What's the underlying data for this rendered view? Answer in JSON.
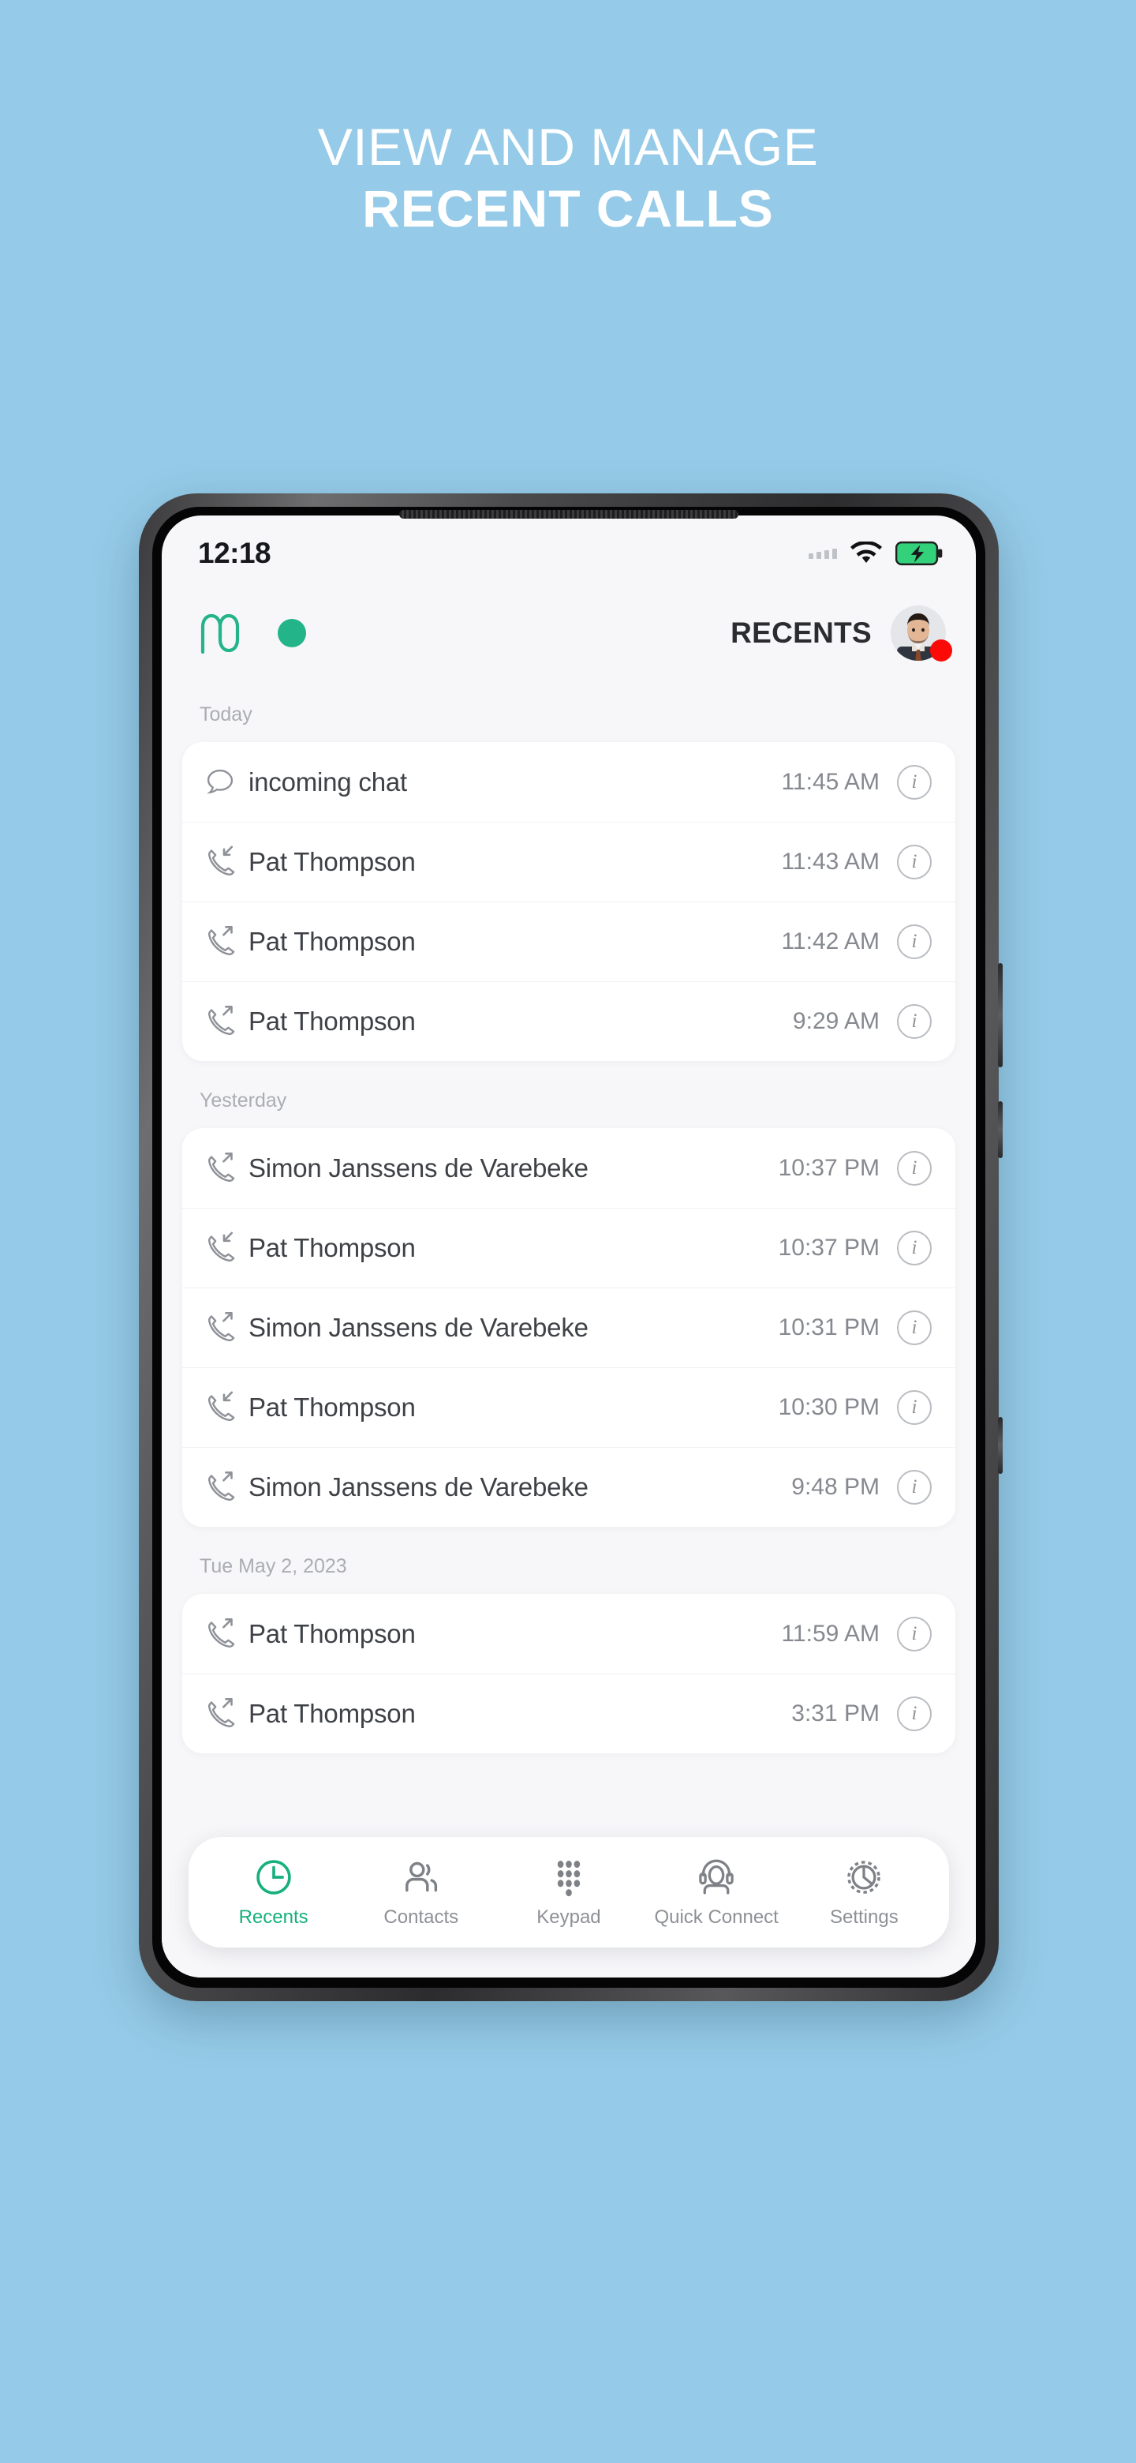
{
  "promo": {
    "line1": "VIEW AND MANAGE",
    "line2": "RECENT CALLS",
    "background_color": "#95cbe8",
    "text_color": "#ffffff"
  },
  "phone": {
    "status_bar": {
      "time": "12:18",
      "signal_icon": "signal-dots-icon",
      "wifi_icon": "wifi-icon",
      "battery_icon": "battery-charging-icon",
      "battery_color": "#2ecc71"
    },
    "app_header": {
      "logo_icon": "mc-logo-icon",
      "logo_color": "#23b48a",
      "presence_dot_icon": "presence-dot-icon",
      "presence_color": "#23b48a",
      "title": "RECENTS",
      "avatar_icon": "user-avatar",
      "badge_icon": "notification-badge",
      "badge_color": "#fb0a08"
    },
    "accent_color": "#17b07e",
    "sections": [
      {
        "label": "Today",
        "calls": [
          {
            "icon": "chat-bubble-icon",
            "type": "chat",
            "name": "incoming chat",
            "time": "11:45 AM",
            "info_icon": "info-icon"
          },
          {
            "icon": "call-incoming-icon",
            "type": "incoming",
            "name": "Pat Thompson",
            "time": "11:43 AM",
            "info_icon": "info-icon"
          },
          {
            "icon": "call-outgoing-icon",
            "type": "outgoing",
            "name": "Pat Thompson",
            "time": "11:42 AM",
            "info_icon": "info-icon"
          },
          {
            "icon": "call-outgoing-icon",
            "type": "outgoing",
            "name": "Pat Thompson",
            "time": "9:29 AM",
            "info_icon": "info-icon"
          }
        ]
      },
      {
        "label": "Yesterday",
        "calls": [
          {
            "icon": "call-outgoing-icon",
            "type": "outgoing",
            "name": "Simon Janssens de Varebeke",
            "time": "10:37 PM",
            "info_icon": "info-icon"
          },
          {
            "icon": "call-incoming-icon",
            "type": "incoming",
            "name": "Pat Thompson",
            "time": "10:37 PM",
            "info_icon": "info-icon"
          },
          {
            "icon": "call-outgoing-icon",
            "type": "outgoing",
            "name": "Simon Janssens de Varebeke",
            "time": "10:31 PM",
            "info_icon": "info-icon"
          },
          {
            "icon": "call-incoming-icon",
            "type": "incoming",
            "name": "Pat Thompson",
            "time": "10:30 PM",
            "info_icon": "info-icon"
          },
          {
            "icon": "call-outgoing-icon",
            "type": "outgoing",
            "name": "Simon Janssens de Varebeke",
            "time": "9:48 PM",
            "info_icon": "info-icon"
          }
        ]
      },
      {
        "label": "Tue May 2, 2023",
        "calls": [
          {
            "icon": "call-outgoing-icon",
            "type": "outgoing",
            "name": "Pat Thompson",
            "time": "11:59 AM",
            "info_icon": "info-icon"
          },
          {
            "icon": "call-outgoing-icon",
            "type": "outgoing",
            "name": "Pat Thompson",
            "time": "3:31 PM",
            "info_icon": "info-icon"
          }
        ]
      }
    ],
    "bottom_nav": [
      {
        "label": "Recents",
        "icon": "clock-icon",
        "active": true
      },
      {
        "label": "Contacts",
        "icon": "contacts-icon",
        "active": false
      },
      {
        "label": "Keypad",
        "icon": "keypad-icon",
        "active": false
      },
      {
        "label": "Quick Connect",
        "icon": "headset-user-icon",
        "active": false
      },
      {
        "label": "Settings",
        "icon": "gear-icon",
        "active": false
      }
    ]
  }
}
